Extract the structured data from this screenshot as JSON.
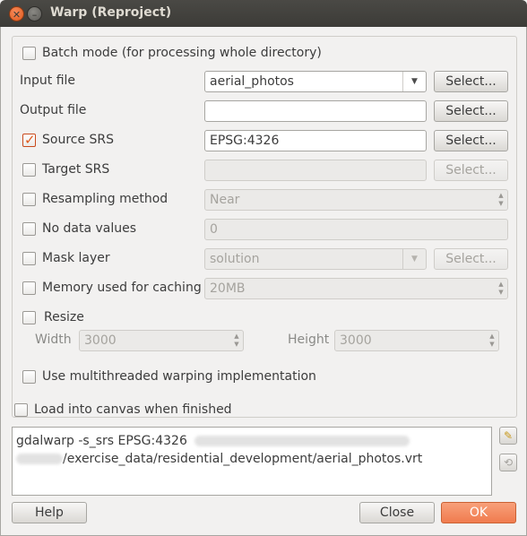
{
  "window": {
    "title": "Warp (Reproject)"
  },
  "batch_mode": {
    "label": "Batch mode (for processing whole directory)",
    "checked": false
  },
  "input_file": {
    "label": "Input file",
    "value": "aerial_photos",
    "button": "Select..."
  },
  "output_file": {
    "label": "Output file",
    "value": "",
    "button": "Select..."
  },
  "source_srs": {
    "label": "Source SRS",
    "checked": true,
    "value": "EPSG:4326",
    "button": "Select..."
  },
  "target_srs": {
    "label": "Target SRS",
    "checked": false,
    "value": "",
    "button": "Select..."
  },
  "resampling": {
    "label": "Resampling method",
    "checked": false,
    "value": "Near"
  },
  "no_data": {
    "label": "No data values",
    "checked": false,
    "value": "0"
  },
  "mask_layer": {
    "label": "Mask layer",
    "checked": false,
    "value": "solution",
    "button": "Select..."
  },
  "memory": {
    "label": "Memory used for caching",
    "checked": false,
    "value": "20MB"
  },
  "resize": {
    "label": "Resize",
    "checked": false,
    "width_label": "Width",
    "width_value": "3000",
    "height_label": "Height",
    "height_value": "3000"
  },
  "multithreaded": {
    "label": "Use multithreaded warping implementation",
    "checked": false
  },
  "load_canvas": {
    "label": "Load into canvas when finished",
    "checked": false
  },
  "command": {
    "line1": "gdalwarp -s_srs EPSG:4326",
    "line2": "/exercise_data/residential_development/aerial_photos.vrt"
  },
  "buttons": {
    "help": "Help",
    "close": "Close",
    "ok": "OK"
  }
}
